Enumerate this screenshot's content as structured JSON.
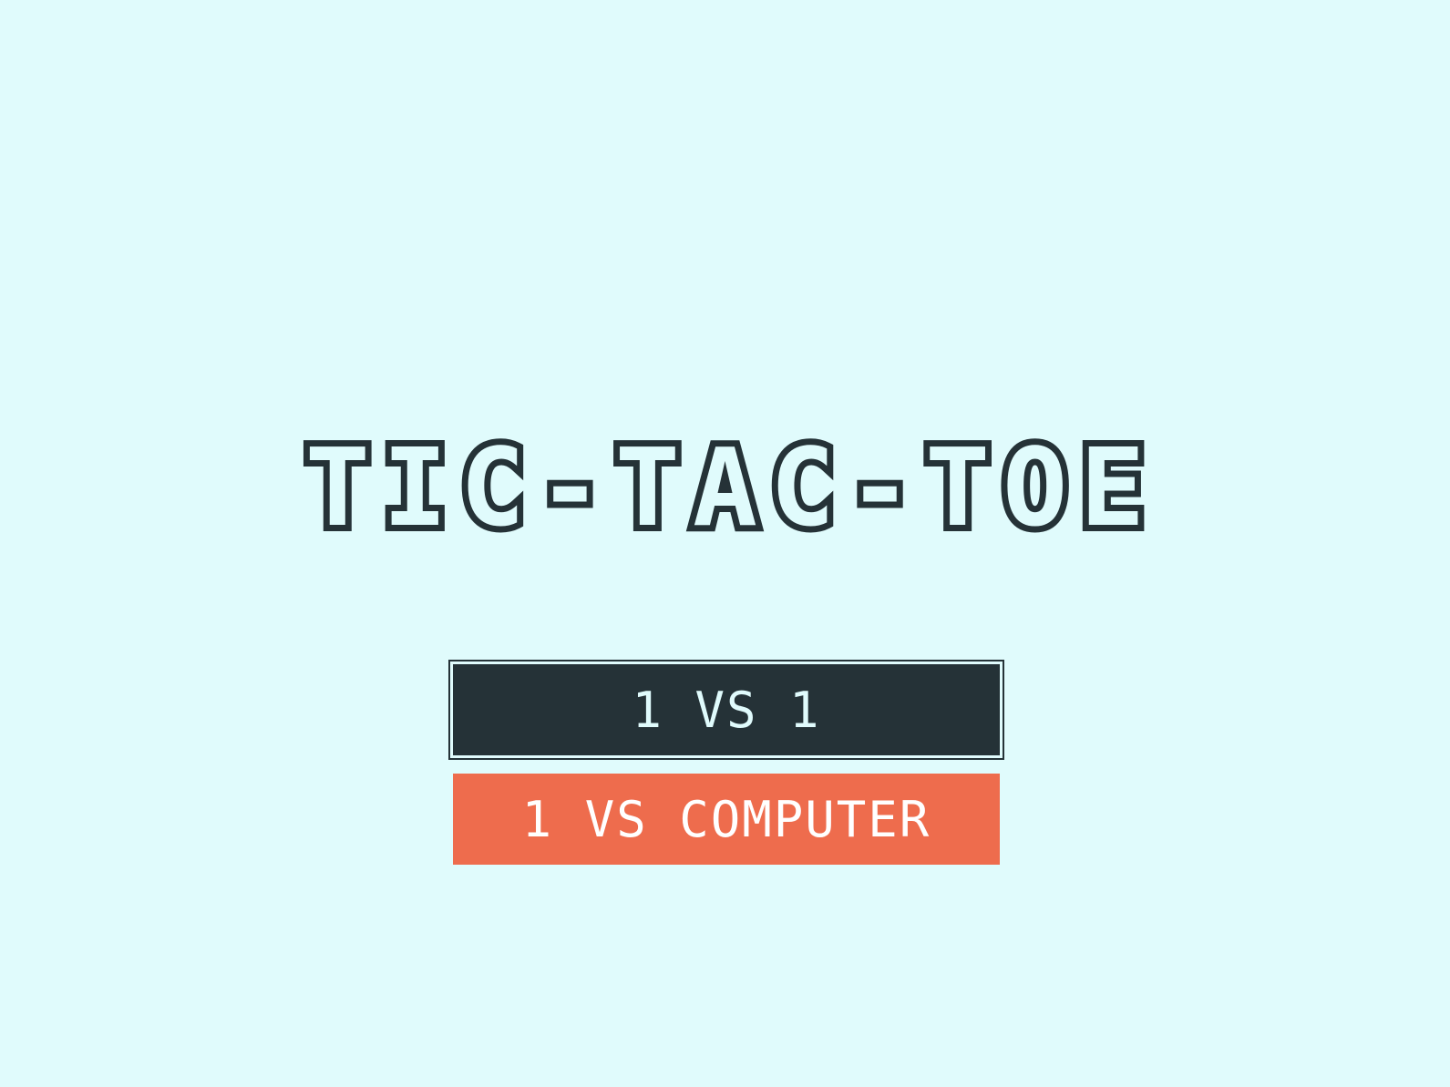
{
  "game": {
    "title": "TIC-TAC-TOE"
  },
  "menu": {
    "options": [
      {
        "label": "1 VS 1",
        "selected": true
      },
      {
        "label": "1 VS COMPUTER",
        "selected": false
      }
    ]
  },
  "colors": {
    "background": "#e0fbfc",
    "dark": "#253237",
    "accent": "#ee6c4d",
    "button_text": "#ffffff"
  }
}
